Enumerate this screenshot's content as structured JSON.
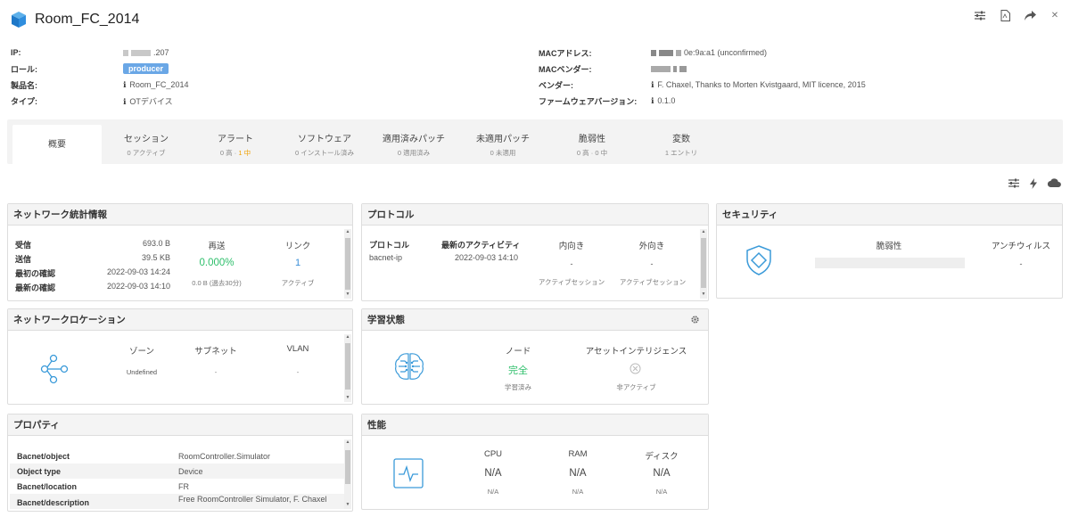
{
  "header": {
    "title": "Room_FC_2014"
  },
  "info_left": [
    {
      "key": "IP:",
      "value": ".207",
      "type": "ip"
    },
    {
      "key": "ロール:",
      "value": "producer",
      "type": "badge"
    },
    {
      "key": "製品名:",
      "value": "Room_FC_2014",
      "type": "info"
    },
    {
      "key": "タイプ:",
      "value": "OTデバイス",
      "type": "info"
    }
  ],
  "info_right": [
    {
      "key": "MACアドレス:",
      "value": "0e:9a:a1 (unconfirmed)",
      "type": "mac"
    },
    {
      "key": "MACベンダー:",
      "value": "",
      "type": "vendor"
    },
    {
      "key": "ベンダー:",
      "value": "F. Chaxel, Thanks to Morten Kvistgaard, MIT licence, 2015",
      "type": "info"
    },
    {
      "key": "ファームウェアバージョン:",
      "value": "0.1.0",
      "type": "info"
    }
  ],
  "tabs": [
    {
      "label": "概要",
      "sub": "",
      "active": true
    },
    {
      "label": "セッション",
      "sub": "0 アクティブ"
    },
    {
      "label": "アラート",
      "sub_pre": "0 高 · ",
      "sub_hl": "1 中"
    },
    {
      "label": "ソフトウェア",
      "sub": "0 インストール済み"
    },
    {
      "label": "適用済みパッチ",
      "sub": "0 適用済み"
    },
    {
      "label": "未適用パッチ",
      "sub": "0 未適用"
    },
    {
      "label": "脆弱性",
      "sub": "0 高 · 0 中"
    },
    {
      "label": "変数",
      "sub": "1 エントリ"
    }
  ],
  "network_stats": {
    "title": "ネットワーク統計情報",
    "rows": [
      {
        "label": "受信",
        "value": "693.0 B"
      },
      {
        "label": "送信",
        "value": "39.5 KB"
      },
      {
        "label": "最初の確認",
        "value": "2022-09-03 14:24"
      },
      {
        "label": "最新の確認",
        "value": "2022-09-03 14:10"
      }
    ],
    "retrans_label": "再送",
    "retrans_value": "0.000%",
    "retrans_sub": "0.0 B (過去30分)",
    "link_label": "リンク",
    "link_value": "1",
    "link_sub": "アクティブ"
  },
  "protocol": {
    "title": "プロトコル",
    "col_protocol": "プロトコル",
    "col_activity": "最新のアクティビティ",
    "col_in": "内向き",
    "col_out": "外向き",
    "row_protocol": "bacnet-ip",
    "row_activity": "2022-09-03 14:10",
    "row_in": "-",
    "row_out": "-",
    "in_sub": "アクティブセッション",
    "out_sub": "アクティブセッション"
  },
  "security": {
    "title": "セキュリティ",
    "vuln_label": "脆弱性",
    "av_label": "アンチウィルス",
    "av_value": "-"
  },
  "network_location": {
    "title": "ネットワークロケーション",
    "zone_label": "ゾーン",
    "zone_value": "Undefined",
    "subnet_label": "サブネット",
    "subnet_value": "-",
    "vlan_label": "VLAN",
    "vlan_value": "-"
  },
  "learning": {
    "title": "学習状態",
    "node_label": "ノード",
    "node_value": "完全",
    "node_sub": "学習済み",
    "ai_label": "アセットインテリジェンス",
    "ai_sub": "非アクティブ"
  },
  "properties": {
    "title": "プロパティ",
    "rows": [
      {
        "key": "Bacnet/object",
        "value": "RoomController.Simulator"
      },
      {
        "key": "Object type",
        "value": "Device"
      },
      {
        "key": "Bacnet/location",
        "value": "FR"
      },
      {
        "key": "Bacnet/description",
        "value": "Free RoomController Simulator, F. Chaxel"
      }
    ]
  },
  "performance": {
    "title": "性能",
    "cpu_label": "CPU",
    "cpu_value": "N/A",
    "cpu_sub": "N/A",
    "ram_label": "RAM",
    "ram_value": "N/A",
    "ram_sub": "N/A",
    "disk_label": "ディスク",
    "disk_value": "N/A",
    "disk_sub": "N/A"
  }
}
